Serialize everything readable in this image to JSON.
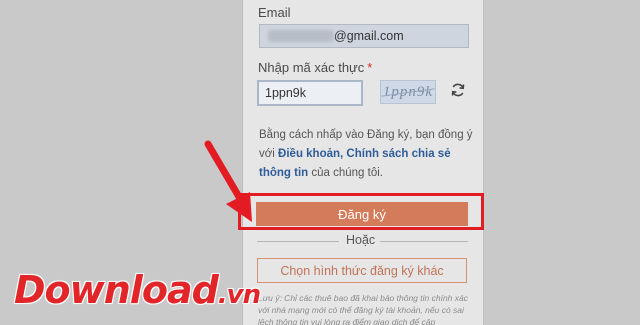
{
  "form": {
    "email_label": "Email",
    "email_value": "@gmail.com",
    "captcha_label": "Nhập mã xác thực",
    "required_mark": "*",
    "captcha_input_value": "1ppn9k",
    "captcha_image_text": "1ppn9k",
    "refresh_icon": "refresh-icon",
    "terms_prefix": "Bằng cách nhấp vào Đăng ký, bạn đồng ý với ",
    "terms_link": "Điều khoản, Chính sách chia sẻ thông tin",
    "terms_suffix": " của chúng tôi.",
    "register_button": "Đăng ký",
    "or_text": "Hoặc",
    "alt_button": "Chọn hình thức đăng ký khác",
    "note": "Lưu ý: Chỉ các thuê bao đã khai báo thông tin chính xác với nhà mạng mới có thể đăng ký tài khoản, nếu có sai lệch thông tin vui lòng ra điểm giao dịch để cập"
  },
  "watermark": {
    "brand": "Download",
    "suffix": ".vn"
  },
  "colors": {
    "accent": "#d47b5c",
    "highlight": "#e31b23",
    "link": "#2f5c9a"
  }
}
